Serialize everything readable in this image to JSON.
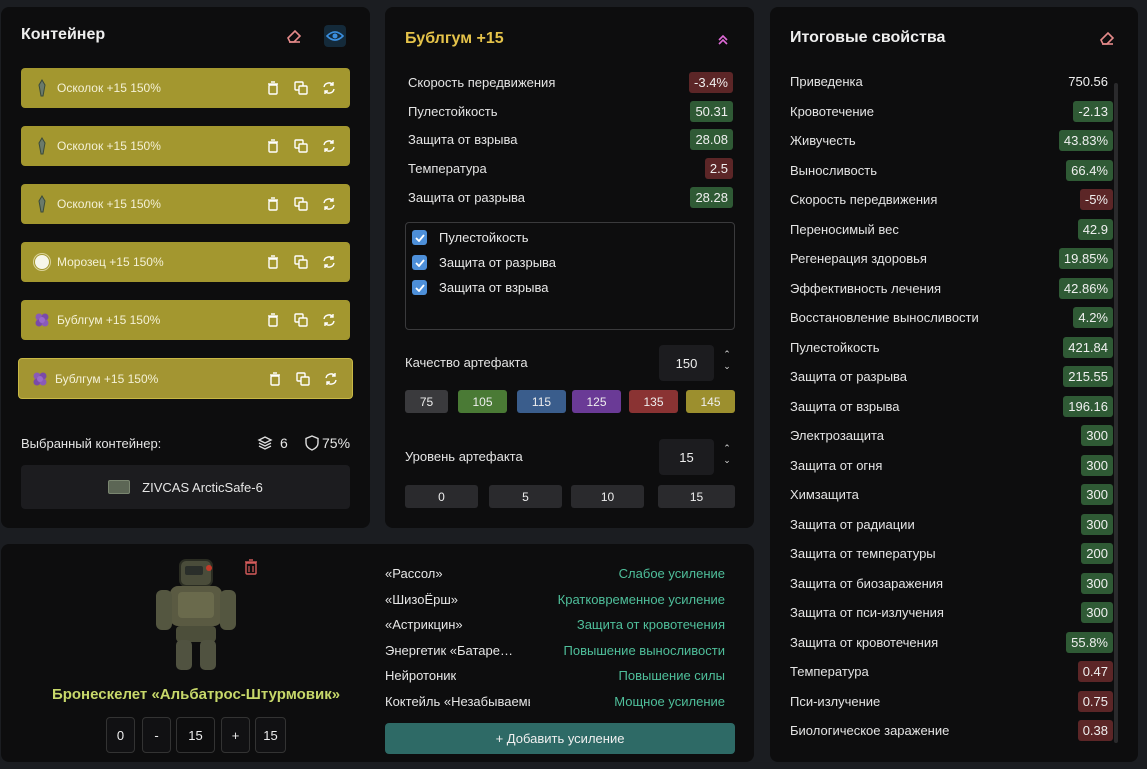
{
  "container": {
    "title": "Контейнер",
    "items": [
      {
        "label": "Осколок +15 150%",
        "icon": "shard-icon"
      },
      {
        "label": "Осколок +15 150%",
        "icon": "shard-icon"
      },
      {
        "label": "Осколок +15 150%",
        "icon": "shard-icon"
      },
      {
        "label": "Морозец +15 150%",
        "icon": "frost-icon"
      },
      {
        "label": "Бублгум +15 150%",
        "icon": "bubblegum-icon"
      },
      {
        "label": "Бублгум +15 150%",
        "icon": "bubblegum-icon"
      }
    ],
    "selected_label": "Выбранный контейнер:",
    "slots": "6",
    "protection": "75%",
    "container_name": "ZIVCAS ArcticSafe-6"
  },
  "artifact": {
    "title": "Бублгум +15",
    "stats": [
      {
        "name": "Скорость передвижения",
        "value": "-3.4%",
        "tone": "red"
      },
      {
        "name": "Пулестойкость",
        "value": "50.31",
        "tone": "green"
      },
      {
        "name": "Защита от взрыва",
        "value": "28.08",
        "tone": "green"
      },
      {
        "name": "Температура",
        "value": "2.5",
        "tone": "red"
      },
      {
        "name": "Защита от разрыва",
        "value": "28.28",
        "tone": "green"
      }
    ],
    "checks": [
      "Пулестойкость",
      "Защита от разрыва",
      "Защита от взрыва"
    ],
    "quality_label": "Качество артефакта",
    "quality_value": "150",
    "quality_presets": [
      {
        "label": "75",
        "color": "#3a3a3d"
      },
      {
        "label": "105",
        "color": "#4a7a35"
      },
      {
        "label": "115",
        "color": "#3a5d8c"
      },
      {
        "label": "125",
        "color": "#6a3a96"
      },
      {
        "label": "135",
        "color": "#8a3333"
      },
      {
        "label": "145",
        "color": "#9c8f2e"
      }
    ],
    "level_label": "Уровень артефакта",
    "level_value": "15",
    "level_presets": [
      "0",
      "5",
      "10",
      "15"
    ]
  },
  "totals": {
    "title": "Итоговые свойства",
    "rows": [
      {
        "name": "Приведенка",
        "value": "750.56",
        "tone": "none"
      },
      {
        "name": "Кровотечение",
        "value": "-2.13",
        "tone": "green"
      },
      {
        "name": "Живучесть",
        "value": "43.83%",
        "tone": "green"
      },
      {
        "name": "Выносливость",
        "value": "66.4%",
        "tone": "green"
      },
      {
        "name": "Скорость передвижения",
        "value": "-5%",
        "tone": "red"
      },
      {
        "name": "Переносимый вес",
        "value": "42.9",
        "tone": "green"
      },
      {
        "name": "Регенерация здоровья",
        "value": "19.85%",
        "tone": "green"
      },
      {
        "name": "Эффективность лечения",
        "value": "42.86%",
        "tone": "green"
      },
      {
        "name": "Восстановление выносливости",
        "value": "4.2%",
        "tone": "green"
      },
      {
        "name": "Пулестойкость",
        "value": "421.84",
        "tone": "green"
      },
      {
        "name": "Защита от разрыва",
        "value": "215.55",
        "tone": "green"
      },
      {
        "name": "Защита от взрыва",
        "value": "196.16",
        "tone": "green"
      },
      {
        "name": "Электрозащита",
        "value": "300",
        "tone": "green"
      },
      {
        "name": "Защита от огня",
        "value": "300",
        "tone": "green"
      },
      {
        "name": "Химзащита",
        "value": "300",
        "tone": "green"
      },
      {
        "name": "Защита от радиации",
        "value": "300",
        "tone": "green"
      },
      {
        "name": "Защита от температуры",
        "value": "200",
        "tone": "green"
      },
      {
        "name": "Защита от биозаражения",
        "value": "300",
        "tone": "green"
      },
      {
        "name": "Защита от пси-излучения",
        "value": "300",
        "tone": "green"
      },
      {
        "name": "Защита от кровотечения",
        "value": "55.8%",
        "tone": "green"
      },
      {
        "name": "Температура",
        "value": "0.47",
        "tone": "red"
      },
      {
        "name": "Пси-излучение",
        "value": "0.75",
        "tone": "red"
      },
      {
        "name": "Биологическое заражение",
        "value": "0.38",
        "tone": "red"
      }
    ]
  },
  "armor": {
    "name": "Бронескелет «Альбатрос-Штурмовик»",
    "ctrl": [
      "0",
      "-",
      "15",
      "+",
      "15"
    ]
  },
  "boosts": {
    "rows": [
      {
        "name": "«Рассол»",
        "value": "Слабое усиление"
      },
      {
        "name": "«ШизоЁрш»",
        "value": "Кратковременное усиление"
      },
      {
        "name": "«Астрикцин»",
        "value": "Защита от кровотечения"
      },
      {
        "name": "Энергетик «Батаре…",
        "value": "Повышение выносливости"
      },
      {
        "name": "Нейротоник",
        "value": "Повышение силы"
      },
      {
        "name": "Коктейль «Незабываемый»",
        "value": "Мощное усиление"
      }
    ],
    "add_label": "+ Добавить усиление"
  }
}
